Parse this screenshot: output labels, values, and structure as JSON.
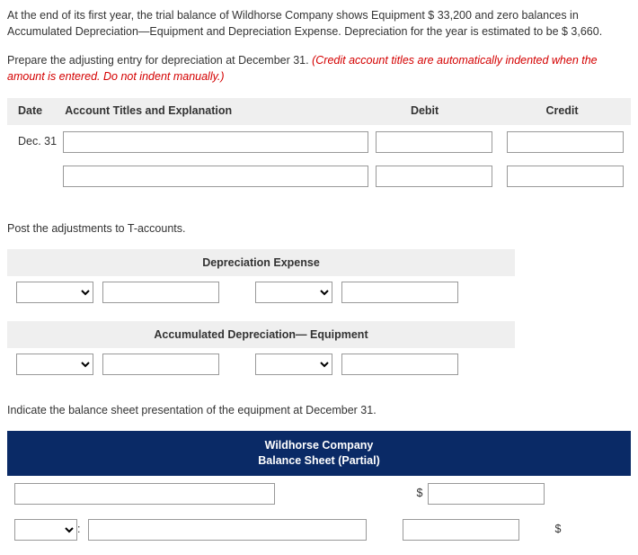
{
  "intro": {
    "p1": "At the end of its first year, the trial balance of Wildhorse Company shows Equipment $ 33,200 and zero balances in Accumulated Depreciation—Equipment and Depreciation Expense. Depreciation for the year is estimated to be $ 3,660.",
    "p2a": "Prepare the adjusting entry for depreciation at December 31. ",
    "p2b": "(Credit account titles are automatically indented when the amount is entered. Do not indent manually.)"
  },
  "je": {
    "headers": {
      "date": "Date",
      "acct": "Account Titles and Explanation",
      "debit": "Debit",
      "credit": "Credit"
    },
    "date_label": "Dec. 31"
  },
  "t_section": {
    "intro": "Post the adjustments to T-accounts.",
    "acct1": "Depreciation Expense",
    "acct2": "Accumulated Depreciation— Equipment"
  },
  "bs": {
    "intro": "Indicate the balance sheet presentation of the equipment at December 31.",
    "company": "Wildhorse Company",
    "title": "Balance Sheet (Partial)",
    "dollar": "$",
    "colon": ":"
  }
}
